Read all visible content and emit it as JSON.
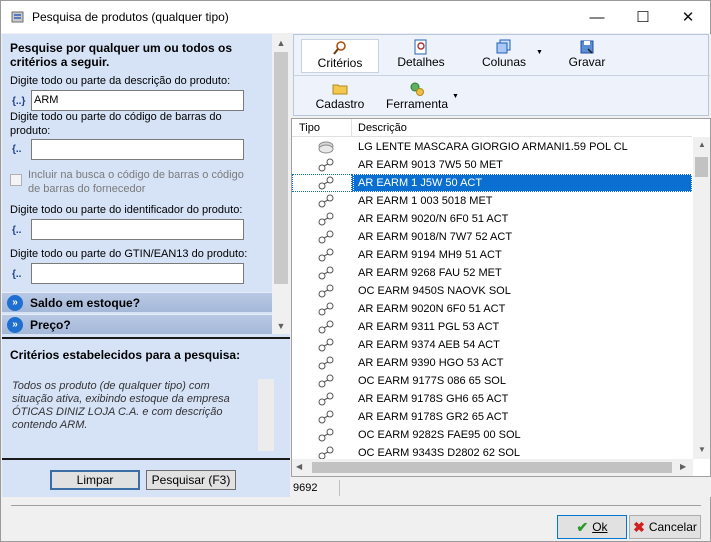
{
  "window": {
    "title": "Pesquisa de produtos (qualquer tipo)",
    "minimize": "—",
    "maximize": "☐",
    "close": "✕"
  },
  "search": {
    "header": "Pesquise por qualquer um ou todos os critérios a seguir.",
    "desc_label": "Digite todo ou parte da descrição do produto:",
    "desc_value": "ARM",
    "barcode_label": "Digite todo ou parte do código de barras do produto:",
    "barcode_value": "",
    "supplier_barcode_label": "Incluir na busca o código de barras o código de barras do fornecedor",
    "id_label": "Digite todo ou parte do identificador do produto:",
    "id_value": "",
    "gtin_label": "Digite todo ou parte do GTIN/EAN13 do produto:",
    "gtin_value": "",
    "sections": [
      "Saldo em estoque?",
      "Preço?"
    ]
  },
  "criteria": {
    "title": "Critérios estabelecidos para a pesquisa:",
    "text": "Todos os produto (de qualquer tipo) com situação ativa, exibindo estoque da empresa ÓTICAS DINIZ LOJA C.A. e com descrição contendo ARM."
  },
  "actions": {
    "clear": "Limpar",
    "search": "Pesquisar (F3)"
  },
  "toolbar": {
    "criteria": "Critérios",
    "details": "Detalhes",
    "columns": "Colunas",
    "record": "Gravar",
    "register": "Cadastro",
    "tool": "Ferramenta"
  },
  "grid": {
    "col_type": "Tipo",
    "col_desc": "Descrição",
    "rows": [
      "LG LENTE MASCARA GIORGIO ARMANI1.59 POL CL",
      "AR EARM 9013 7W5 50 MET",
      "AR EARM 1 J5W 50 ACT",
      "AR EARM 1 003 5018 MET",
      "AR EARM 9020/N 6F0 51 ACT",
      "AR EARM 9018/N 7W7 52 ACT",
      "AR EARM 9194 MH9 51 ACT",
      "AR EARM 9268 FAU 52 MET",
      "OC EARM 9450S NAOVK  SOL",
      "AR EARM 9020N 6F0 51 ACT",
      "AR EARM 9311 PGL 53 ACT",
      "AR EARM 9374 AEB 54 ACT",
      "AR EARM 9390 HGO 53 ACT",
      "OC EARM 9177S 086 65 SOL",
      "AR EARM 9178S GH6 65 ACT",
      "AR EARM 9178S GR2 65 ACT",
      "OC EARM 9282S FAE95 00 SOL",
      "OC EARM 9343S D2802 62 SOL"
    ],
    "selected_index": 2,
    "count": "9692"
  },
  "footer": {
    "ok": "Ok",
    "cancel": "Cancelar"
  }
}
